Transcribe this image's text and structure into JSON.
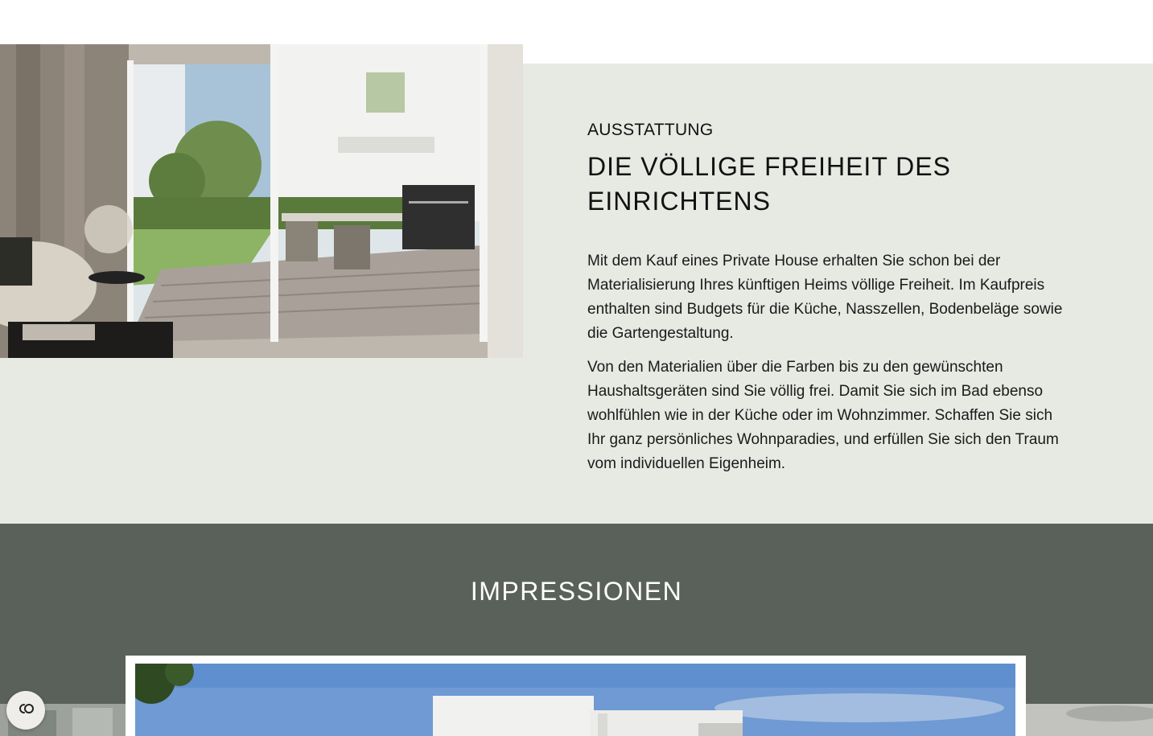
{
  "feature": {
    "eyebrow": "AUSSTATTUNG",
    "headline": "DIE VÖLLIGE FREIHEIT DES EINRICHTENS",
    "paragraphs": [
      "Mit dem Kauf eines Private House erhalten Sie schon bei der Materialisierung Ihres künftigen Heims völlige Freiheit. Im Kaufpreis enthalten sind Budgets für die Küche, Nasszellen, Bodenbeläge sowie die Gartengestaltung.",
      "Von den Materialien über die Farben bis zu den gewünschten Haushaltsgeräten sind Sie völlig frei. Damit Sie sich im Bad ebenso wohlfühlen wie in der Küche oder im Wohnzimmer. Schaffen Sie sich Ihr ganz persönliches Wohnparadies, und erfüllen Sie sich den Traum vom individuellen Eigenheim."
    ],
    "photo_icon": "interior-terrace-photo"
  },
  "impressions": {
    "title": "IMPRESSIONEN",
    "main_photo_icon": "house-exterior-photo"
  },
  "cookie": {
    "icon": "cookie-consent-icon"
  },
  "colors": {
    "feature_band": "#e7e9e3",
    "impressions_band": "#5a615a",
    "text": "#111111"
  }
}
